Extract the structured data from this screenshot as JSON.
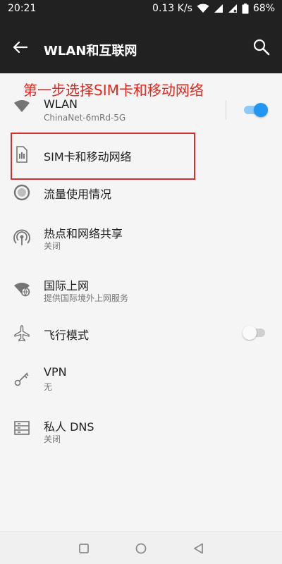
{
  "status_bar": {
    "time": "20:21",
    "network_speed": "0.13 K/s",
    "battery": "68%"
  },
  "app_bar": {
    "title": "WLAN和互联网"
  },
  "annotation": "第一步选择SIM卡和移动网络",
  "items": [
    {
      "label": "WLAN",
      "sub": "ChinaNet-6mRd-5G",
      "icon": "wifi-icon",
      "toggle": true
    },
    {
      "label": "SIM卡和移动网络",
      "icon": "sim-card-icon"
    },
    {
      "label": "流量使用情况",
      "icon": "data-usage-icon"
    },
    {
      "label": "热点和网络共享",
      "sub": "关闭",
      "icon": "hotspot-icon"
    },
    {
      "label": "国际上网",
      "sub": "提供国际境外上网服务",
      "icon": "globe-wifi-icon"
    },
    {
      "label": "飞行模式",
      "icon": "airplane-icon",
      "toggle": false
    },
    {
      "label": "VPN",
      "sub": "无",
      "icon": "key-icon"
    },
    {
      "label": "私人 DNS",
      "sub": "关闭",
      "icon": "dns-icon"
    }
  ],
  "colors": {
    "accent": "#2196f3",
    "annotation": "#e0281e",
    "highlight_border": "#d32f2f",
    "dark_bar": "#212121"
  }
}
